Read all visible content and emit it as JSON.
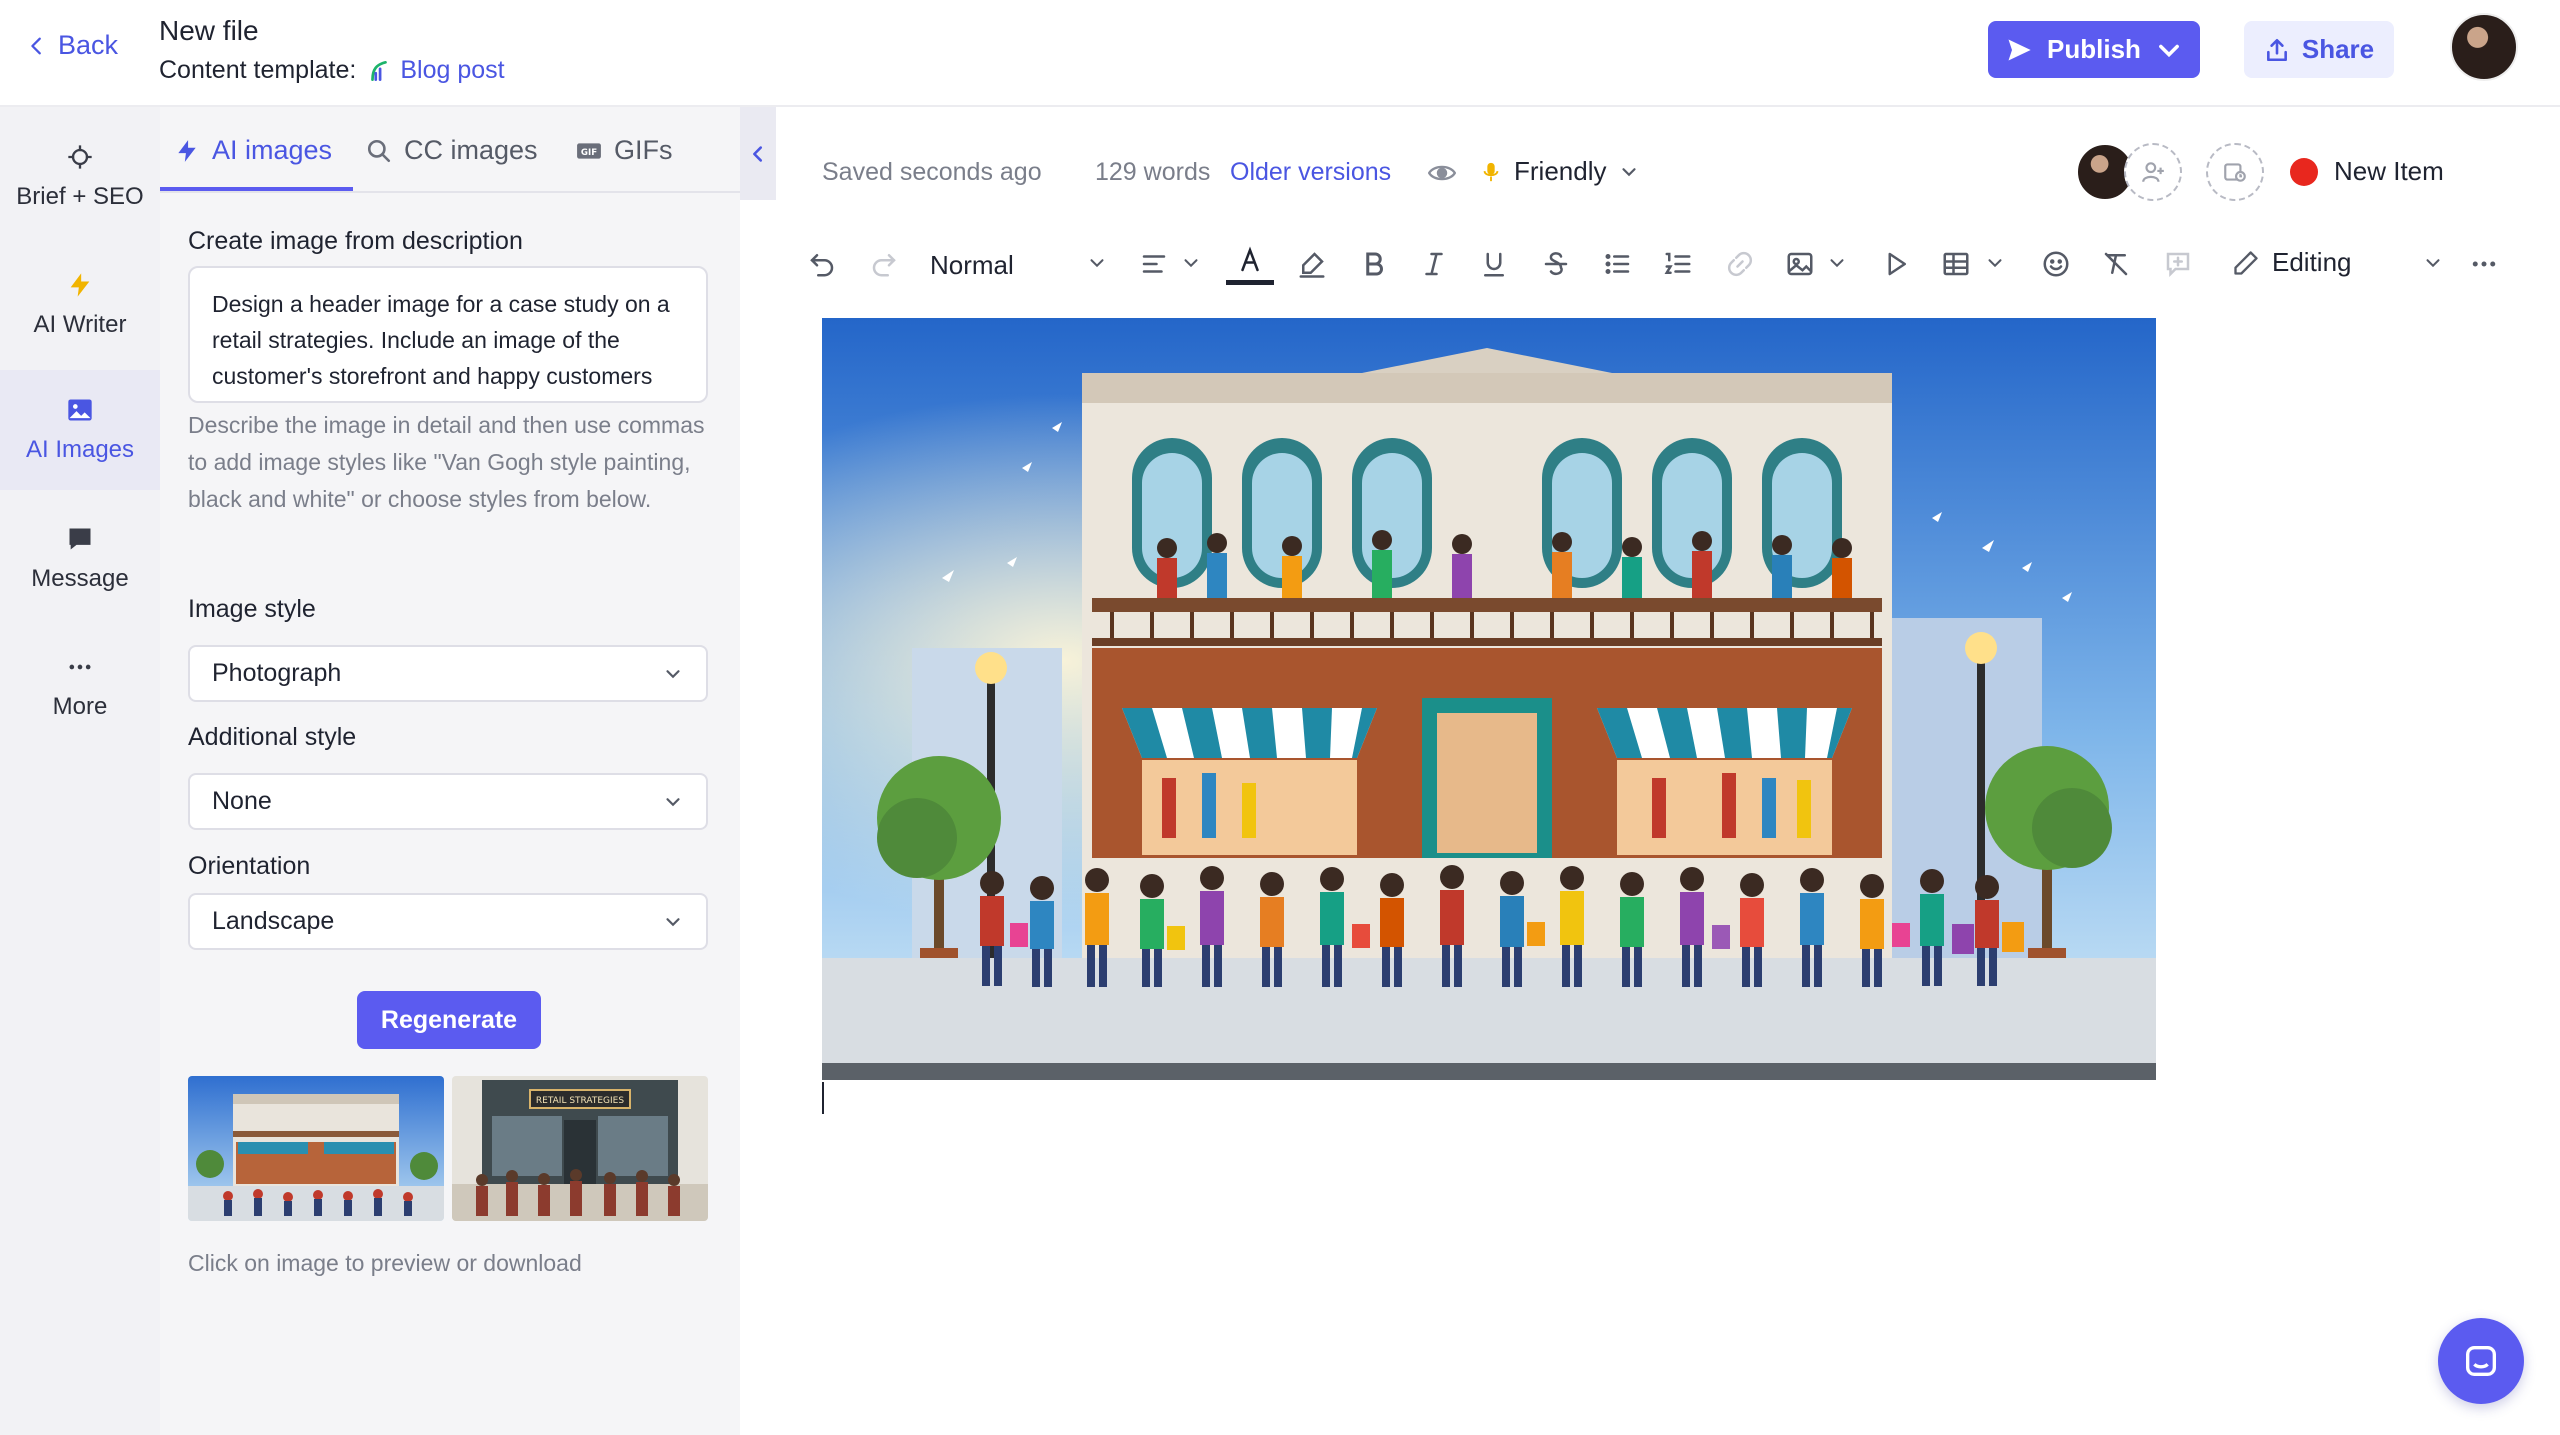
{
  "header": {
    "back_label": "Back",
    "title": "New file",
    "template_prefix": "Content template:",
    "template_name": "Blog post",
    "publish_label": "Publish",
    "share_label": "Share"
  },
  "rail": {
    "items": [
      {
        "label": "Brief + SEO",
        "icon": "crosshair-icon"
      },
      {
        "label": "AI Writer",
        "icon": "lightning-icon"
      },
      {
        "label": "AI Images",
        "icon": "image-icon"
      },
      {
        "label": "Message",
        "icon": "chat-icon"
      },
      {
        "label": "More",
        "icon": "ellipsis-icon"
      }
    ],
    "active_index": 2
  },
  "panel": {
    "tabs": [
      {
        "label": "AI images",
        "icon": "lightning-icon"
      },
      {
        "label": "CC images",
        "icon": "search-icon"
      },
      {
        "label": "GIFs",
        "icon": "gif-icon"
      }
    ],
    "describe_label": "Create image from description",
    "description": "Design a header image for a case study on a retail strategies. Include an image of the customer's storefront and happy customers shopping",
    "help_text": "Describe the image in detail and then use commas to add image styles like \"Van Gogh style painting, black and white\" or choose styles from below.",
    "image_style_label": "Image style",
    "image_style_value": "Photograph",
    "additional_style_label": "Additional style",
    "additional_style_value": "None",
    "orientation_label": "Orientation",
    "orientation_value": "Landscape",
    "regenerate_label": "Regenerate",
    "thumb2_sign": "RETAIL STRATEGIES",
    "click_hint": "Click on image to preview or download"
  },
  "editor": {
    "saved_text": "Saved seconds ago",
    "word_count": "129 words",
    "older_versions": "Older versions",
    "tone": "Friendly",
    "new_item": "New Item",
    "paragraph_style": "Normal",
    "mode": "Editing"
  },
  "colors": {
    "accent": "#5b5bf0",
    "link": "#4a56e2",
    "status_dot": "#e8271e"
  }
}
